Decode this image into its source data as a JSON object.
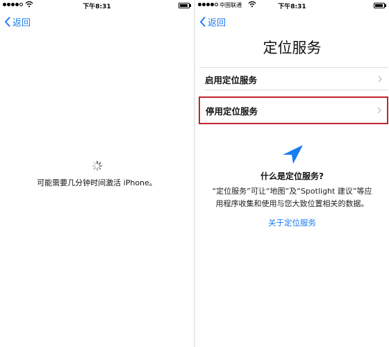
{
  "left": {
    "status": {
      "time": "下午8:31"
    },
    "back_label": "返回",
    "loading_text": "可能需要几分钟时间激活 iPhone。"
  },
  "right": {
    "status": {
      "carrier": "中国联通",
      "time": "下午8:31"
    },
    "back_label": "返回",
    "title": "定位服务",
    "options": [
      {
        "label": "启用定位服务"
      },
      {
        "label": "停用定位服务"
      }
    ],
    "selected_option": "停用定位服务",
    "info": {
      "question": "什么是定位服务?",
      "desc_line1": "“定位服务”可让“地图”及“Spotlight 建议”等应",
      "desc_line2": "用程序收集和使用与您大致位置相关的数据。",
      "link_label": "关于定位服务"
    }
  },
  "colors": {
    "accent": "#1a7cf3",
    "highlight_border": "#c2222e"
  },
  "icons": [
    "signal-icon",
    "wifi-icon",
    "battery-icon",
    "chevron-left-icon",
    "spinner-icon",
    "chevron-right-icon",
    "location-arrow-icon"
  ]
}
